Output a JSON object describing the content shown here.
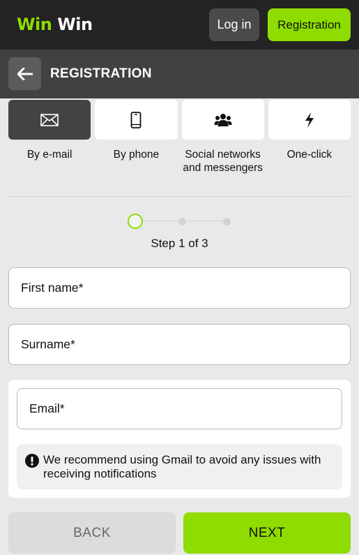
{
  "brand": {
    "logo_part1": "Win",
    "logo_part2": "Win",
    "accent_color": "#8fdc00"
  },
  "header": {
    "login_label": "Log in",
    "register_label": "Registration"
  },
  "page": {
    "title": "REGISTRATION",
    "back_icon": "arrow-left-icon"
  },
  "methods": [
    {
      "label": "By e-mail",
      "icon": "envelope-icon",
      "active": true
    },
    {
      "label": "By phone",
      "icon": "smartphone-icon",
      "active": false
    },
    {
      "label": "Social networks and messengers",
      "icon": "users-icon",
      "active": false
    },
    {
      "label": "One-click",
      "icon": "lightning-icon",
      "active": false
    }
  ],
  "stepper": {
    "current": 1,
    "total": 3,
    "text": "Step 1 of 3"
  },
  "form": {
    "first_name_placeholder": "First name*",
    "surname_placeholder": "Surname*",
    "email_placeholder": "Email*",
    "notice": "We recommend using Gmail to avoid any issues with receiving notifications",
    "notice_icon": "exclamation-circle-icon"
  },
  "actions": {
    "back_label": "BACK",
    "next_label": "NEXT"
  }
}
